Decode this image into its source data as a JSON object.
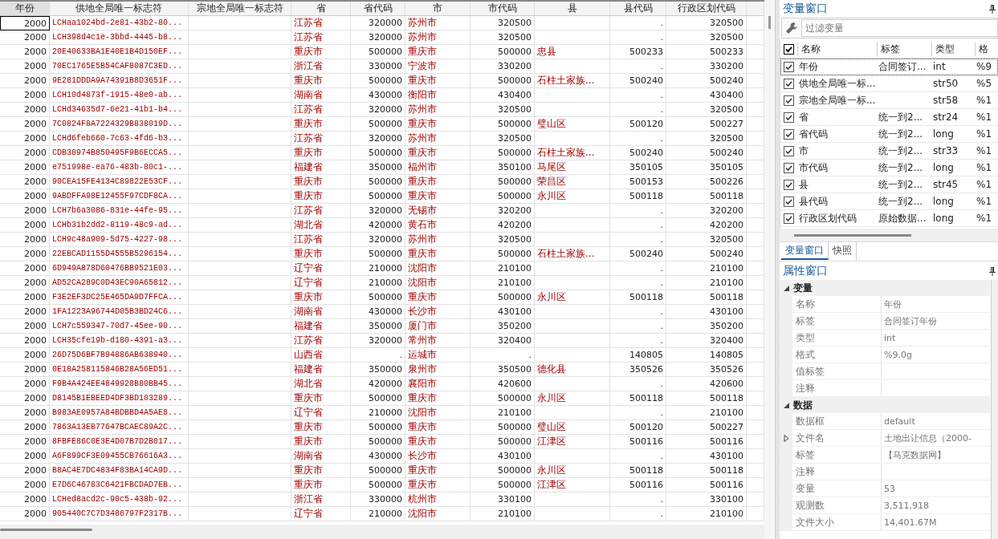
{
  "table": {
    "columns": [
      {
        "label": "年份",
        "kind": "num"
      },
      {
        "label": "供地全局唯一标志符",
        "kind": "str"
      },
      {
        "label": "宗地全局唯一标志符",
        "kind": "str"
      },
      {
        "label": "省",
        "kind": "str"
      },
      {
        "label": "省代码",
        "kind": "num"
      },
      {
        "label": "市",
        "kind": "str"
      },
      {
        "label": "市代码",
        "kind": "num"
      },
      {
        "label": "县",
        "kind": "str"
      },
      {
        "label": "县代码",
        "kind": "num"
      },
      {
        "label": "行政区划代码",
        "kind": "num"
      }
    ],
    "rows": [
      [
        "2000",
        "LCHaa1024bd-2e81-43b2-80...",
        "",
        "江苏省",
        "320000",
        "苏州市",
        "320500",
        "",
        ".",
        "320500"
      ],
      [
        "2000",
        "LCH398d4c1e-3bbd-4445-b8...",
        "",
        "江苏省",
        "320000",
        "苏州市",
        "320500",
        "",
        ".",
        "320500"
      ],
      [
        "2000",
        "20E40633BA1E40E1B4D150EF...",
        "",
        "重庆市",
        "500000",
        "重庆市",
        "500000",
        "忠县",
        "500233",
        "500233"
      ],
      [
        "2000",
        "70EC1765E5B54CAF8087C3ED...",
        "",
        "浙江省",
        "330000",
        "宁波市",
        "330200",
        "",
        ".",
        "330200"
      ],
      [
        "2000",
        "9E281DDDA9A74391B8D3651F...",
        "",
        "重庆市",
        "500000",
        "重庆市",
        "500000",
        "石柱土家族...",
        "500240",
        "500240"
      ],
      [
        "2000",
        "LCH10d4873f-1915-48e0-ab...",
        "",
        "湖南省",
        "430000",
        "衡阳市",
        "430400",
        "",
        ".",
        "430400"
      ],
      [
        "2000",
        "LCHd34635d7-6e21-41b1-b4...",
        "",
        "江苏省",
        "320000",
        "苏州市",
        "320500",
        "",
        ".",
        "320500"
      ],
      [
        "2000",
        "7C0824F8A7224329B838019D...",
        "",
        "重庆市",
        "500000",
        "重庆市",
        "500000",
        "璧山区",
        "500120",
        "500227"
      ],
      [
        "2000",
        "LCHd6feb660-7c63-4fd6-b3...",
        "",
        "江苏省",
        "320000",
        "苏州市",
        "320500",
        "",
        ".",
        "320500"
      ],
      [
        "2000",
        "CDB38974B850495F9B6ECCA5...",
        "",
        "重庆市",
        "500000",
        "重庆市",
        "500000",
        "石柱土家族...",
        "500240",
        "500240"
      ],
      [
        "2000",
        "e751998e-ea76-483b-80c1-...",
        "",
        "福建省",
        "350000",
        "福州市",
        "350100",
        "马尾区",
        "350105",
        "350105"
      ],
      [
        "2000",
        "90CEA15FE4134C89822E53CF...",
        "",
        "重庆市",
        "500000",
        "重庆市",
        "500000",
        "荣昌区",
        "500153",
        "500226"
      ],
      [
        "2000",
        "9ABDFFA98E12455F97CDF8CA...",
        "",
        "重庆市",
        "500000",
        "重庆市",
        "500000",
        "永川区",
        "500118",
        "500118"
      ],
      [
        "2000",
        "LCH7b6a3086-831e-44fe-95...",
        "",
        "江苏省",
        "320000",
        "无锡市",
        "320200",
        "",
        ".",
        "320200"
      ],
      [
        "2000",
        "LCHb31b2dd2-8119-48c9-ad...",
        "",
        "湖北省",
        "420000",
        "黄石市",
        "420200",
        "",
        ".",
        "420200"
      ],
      [
        "2000",
        "LCH9c48a909-5d75-4227-98...",
        "",
        "江苏省",
        "320000",
        "苏州市",
        "320500",
        "",
        ".",
        "320500"
      ],
      [
        "2000",
        "22EBCAD1155D4555B5296154...",
        "",
        "重庆市",
        "500000",
        "重庆市",
        "500000",
        "石柱土家族...",
        "500240",
        "500240"
      ],
      [
        "2000",
        "6D949A878D60476BB9521E03...",
        "",
        "辽宁省",
        "210000",
        "沈阳市",
        "210100",
        "",
        ".",
        "210100"
      ],
      [
        "2000",
        "AD52CA289C0D43EC90A65812...",
        "",
        "辽宁省",
        "210000",
        "沈阳市",
        "210100",
        "",
        ".",
        "210100"
      ],
      [
        "2000",
        "F3E2EF3DC25E465DA9D7FFCA...",
        "",
        "重庆市",
        "500000",
        "重庆市",
        "500000",
        "永川区",
        "500118",
        "500118"
      ],
      [
        "2000",
        "1FA1223A96744D05B3BD24C6...",
        "",
        "湖南省",
        "430000",
        "长沙市",
        "430100",
        "",
        ".",
        "430100"
      ],
      [
        "2000",
        "LCH7c559347-70d7-45ee-90...",
        "",
        "福建省",
        "350000",
        "厦门市",
        "350200",
        "",
        ".",
        "350200"
      ],
      [
        "2000",
        "LCH35cfe19b-d180-4391-a3...",
        "",
        "江苏省",
        "320000",
        "常州市",
        "320400",
        "",
        ".",
        "320400"
      ],
      [
        "2000",
        "26D75D6BF7B94886AB638940...",
        "",
        "山西省",
        ".",
        "运城市",
        ".",
        "",
        "140805",
        "140805"
      ],
      [
        "2000",
        "0E18A258115846B28A56ED51...",
        "",
        "福建省",
        "350000",
        "泉州市",
        "350500",
        "德化县",
        "350526",
        "350526"
      ],
      [
        "2000",
        "F9B4A424EE4849928B80BB45...",
        "",
        "湖北省",
        "420000",
        "襄阳市",
        "420600",
        "",
        ".",
        "420600"
      ],
      [
        "2000",
        "D8145B1EBEED4DF3BD103289...",
        "",
        "重庆市",
        "500000",
        "重庆市",
        "500000",
        "永川区",
        "500118",
        "500118"
      ],
      [
        "2000",
        "B983AE0957A84BDBBD4A5AE8...",
        "",
        "辽宁省",
        "210000",
        "沈阳市",
        "210100",
        "",
        ".",
        "210100"
      ],
      [
        "2000",
        "7863A13EB77647BCAEC89A2C...",
        "",
        "重庆市",
        "500000",
        "重庆市",
        "500000",
        "璧山区",
        "500120",
        "500227"
      ],
      [
        "2000",
        "8FBFE86C0E3E4D07B7D2B017...",
        "",
        "重庆市",
        "500000",
        "重庆市",
        "500000",
        "江津区",
        "500116",
        "500116"
      ],
      [
        "2000",
        "A6F899CF3E09455CB76616A3...",
        "",
        "湖南省",
        "430000",
        "长沙市",
        "430100",
        "",
        ".",
        "430100"
      ],
      [
        "2000",
        "B8AC4E7DC4834F83BA14CA9D...",
        "",
        "重庆市",
        "500000",
        "重庆市",
        "500000",
        "永川区",
        "500118",
        "500118"
      ],
      [
        "2000",
        "E7D6C46783C6421FBCDAD7EB...",
        "",
        "重庆市",
        "500000",
        "重庆市",
        "500000",
        "江津区",
        "500116",
        "500116"
      ],
      [
        "2000",
        "LCHed8acd2c-90c5-438b-92...",
        "",
        "浙江省",
        "330000",
        "杭州市",
        "330100",
        "",
        ".",
        "330100"
      ],
      [
        "2000",
        "905440C7C7D3486797F2317B...",
        "",
        "辽宁省",
        "210000",
        "沈阳市",
        "210100",
        "",
        ".",
        "210100"
      ]
    ]
  },
  "variables": {
    "title": "变量窗口",
    "filter": {
      "placeholder": "过滤变量"
    },
    "all_checked": true,
    "columns": [
      "名称",
      "标签",
      "类型",
      "格"
    ],
    "items": [
      {
        "name": "年份",
        "label": "合同签订...",
        "type": "int",
        "format": "%9",
        "checked": true,
        "selected": true
      },
      {
        "name": "供地全局唯一标...",
        "type": "str50",
        "format": "%5",
        "checked": true,
        "selected": false
      },
      {
        "name": "宗地全局唯一标...",
        "type": "str58",
        "format": "%1",
        "checked": true,
        "selected": false
      },
      {
        "name": "省",
        "label": "统一到2...",
        "type": "str24",
        "format": "%1",
        "checked": true,
        "selected": false
      },
      {
        "name": "省代码",
        "label": "统一到2...",
        "type": "long",
        "format": "%1",
        "checked": true,
        "selected": false
      },
      {
        "name": "市",
        "label": "统一到2...",
        "type": "str33",
        "format": "%1",
        "checked": true,
        "selected": false
      },
      {
        "name": "市代码",
        "label": "统一到2...",
        "type": "long",
        "format": "%1",
        "checked": true,
        "selected": false
      },
      {
        "name": "县",
        "label": "统一到2...",
        "type": "str45",
        "format": "%1",
        "checked": true,
        "selected": false
      },
      {
        "name": "县代码",
        "label": "统一到2...",
        "type": "long",
        "format": "%1",
        "checked": true,
        "selected": false
      },
      {
        "name": "行政区划代码",
        "label": "原始数据...",
        "type": "long",
        "format": "%1",
        "checked": true,
        "selected": false
      }
    ]
  },
  "tabs": [
    {
      "label": "变量窗口",
      "selected": true
    },
    {
      "label": "快照",
      "selected": false
    }
  ],
  "properties": {
    "title": "属性窗口",
    "groups": [
      {
        "label": "变量",
        "expanded": true,
        "items": [
          {
            "name": "名称",
            "value": "年份"
          },
          {
            "name": "标签",
            "value": "合同签订年份"
          },
          {
            "name": "类型",
            "value": "int"
          },
          {
            "name": "格式",
            "value": "%9.0g"
          },
          {
            "name": "值标签",
            "value": ""
          },
          {
            "name": "注释",
            "value": ""
          }
        ]
      },
      {
        "label": "数据",
        "expanded": true,
        "items": [
          {
            "name": "数据框",
            "value": "default"
          },
          {
            "name": "文件名",
            "value": "土地出让信息（2000-",
            "expanded": false
          },
          {
            "name": "标签",
            "value": "【马克数据网】"
          },
          {
            "name": "注释",
            "value": ""
          },
          {
            "name": "变量",
            "value": "53"
          },
          {
            "name": "观测数",
            "value": "3,511,918"
          },
          {
            "name": "文件大小",
            "value": "14,401.67M"
          }
        ]
      }
    ]
  }
}
